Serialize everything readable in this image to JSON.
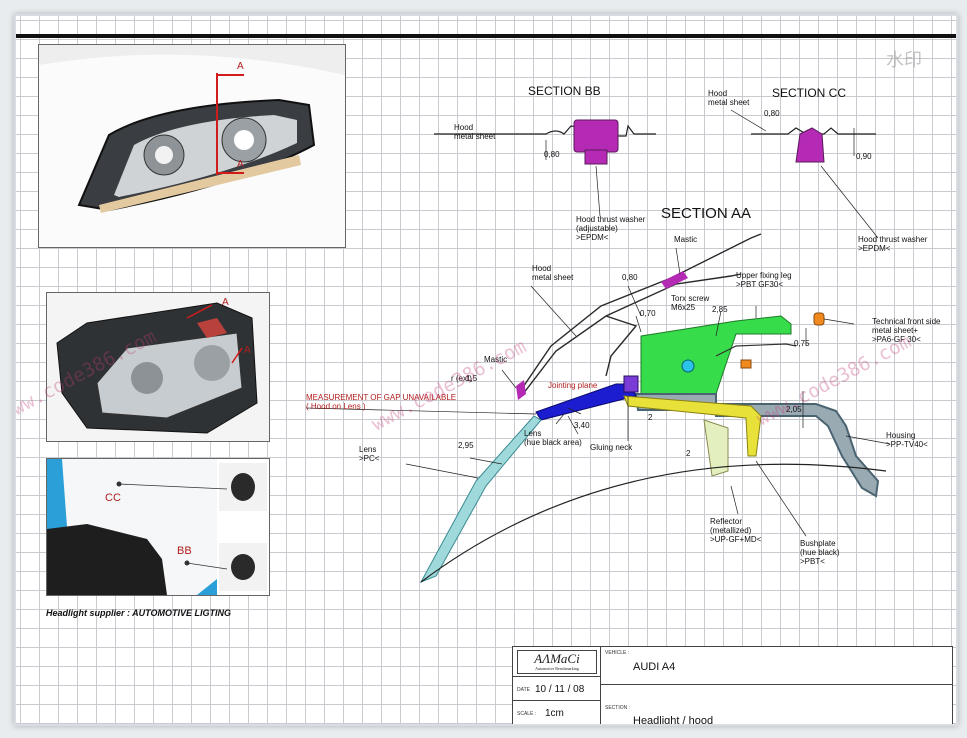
{
  "watermark_corner": "水印",
  "watermark_text": "www.code386.com",
  "photos": {
    "cc_label": "CC",
    "bb_label": "BB",
    "a_label": "A",
    "supplier": "Headlight supplier : AUTOMOTIVE LIGTING"
  },
  "section_bb": {
    "title": "SECTION BB",
    "hood": "Hood\nmetal sheet",
    "dim": "0,80",
    "washer": "Hood thrust washer\n(adjustable)\n>EPDM<"
  },
  "section_cc": {
    "title": "SECTION CC",
    "hood": "Hood\nmetal sheet",
    "dim1": "0,80",
    "dim2": "0,90",
    "washer": "Hood thrust washer\n>EPDM<"
  },
  "section_aa": {
    "title": "SECTION AA",
    "mastic_top": "Mastic",
    "hood": "Hood\nmetal sheet",
    "dim_080": "0,80",
    "dim_070": "0,70",
    "torx": "Torx screw\nM6x25",
    "dim_285": "2,85",
    "upper_leg": "Upper fixing leg\n>PBT GF30<",
    "tech_front": "Technical front side\nmetal sheet+\n>PA6-GF 30<",
    "dim_075": "0,75",
    "mastic_left": "Mastic",
    "r_ext": "r (ext)",
    "r_val": "1,5",
    "measure": "MEASUREMENT OF GAP UNAVAILABLE\n( Hood on Lens )",
    "jointing": "Jointing plane",
    "dim_340": "3,40",
    "dim_2a": "2",
    "dim_2b": "2",
    "dim_205": "2,05",
    "lens_black": "Lens\n(hue black area)",
    "gluing": "Gluing neck",
    "housing": "Housing\n>PP-TV40<",
    "lens": "Lens\n>PC<",
    "dim_295": "2,95",
    "reflector": "Reflector\n(metallized)\n>UP-GF+MD<",
    "bushplate": "Bushplate\n(hue black)\n>PBT<"
  },
  "titleblock": {
    "logo": "AɅMaCi",
    "logo_sub": "Automotive Benchmarking",
    "vehicle_label": "VEHICLE :",
    "vehicle": "AUDI A4",
    "date_label": "DATE",
    "date": "10 / 11 / 08",
    "scale_label": "SCALE :",
    "scale": "1cm",
    "section_label": "SECTION :",
    "section": "Headlight / hood"
  },
  "colors": {
    "washer": "#b42ab4",
    "upper_leg": "#37dc4b",
    "housing": "#4a6472",
    "reflector": "#e8e13a",
    "lens": "#9fd9dc",
    "jointing": "#1c1cd0",
    "tech_clip": "#f08a1e"
  }
}
